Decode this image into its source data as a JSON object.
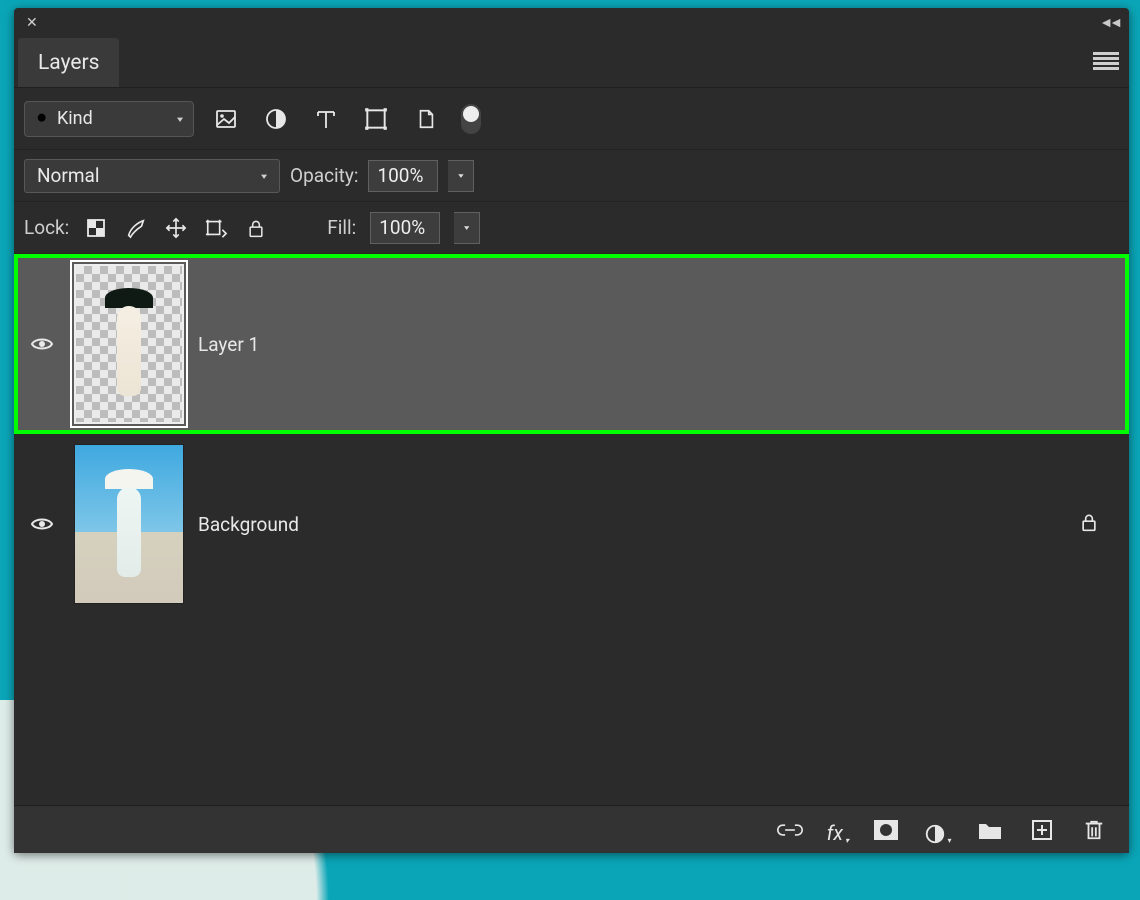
{
  "panel": {
    "tab_label": "Layers"
  },
  "filter": {
    "select_label": "Kind"
  },
  "blend": {
    "mode_label": "Normal",
    "opacity_label": "Opacity:",
    "opacity_value": "100%"
  },
  "lock": {
    "label": "Lock:",
    "fill_label": "Fill:",
    "fill_value": "100%"
  },
  "layers": [
    {
      "name": "Layer 1",
      "selected": true,
      "locked": false,
      "visible": true
    },
    {
      "name": "Background",
      "selected": false,
      "locked": true,
      "visible": true
    }
  ],
  "icons": {
    "search": "search-icon",
    "image": "image-icon",
    "adjustment": "adjustment-icon",
    "type": "type-icon",
    "shape": "shape-icon",
    "smartobj": "smart-object-icon",
    "link": "link-icon",
    "fx": "fx",
    "mask": "mask-icon",
    "adj": "adjustment-layer-icon",
    "group": "group-icon",
    "new": "new-layer-icon",
    "trash": "trash-icon"
  }
}
